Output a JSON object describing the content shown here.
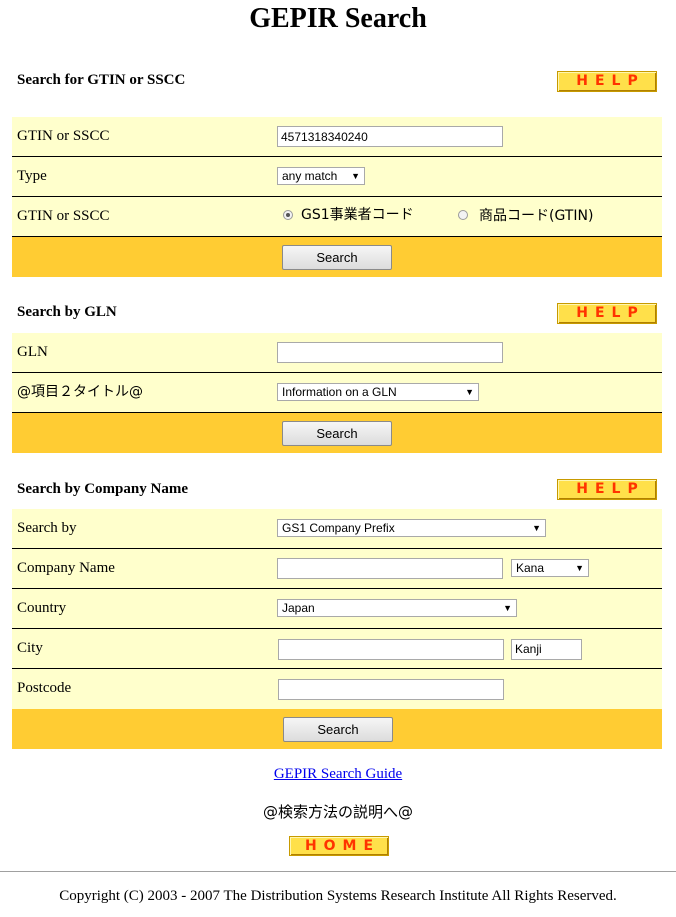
{
  "page": {
    "title": "GEPIR Search"
  },
  "help_label": "HELP",
  "home_label": "HOME",
  "gtin_section": {
    "heading": "Search for GTIN or SSCC",
    "rows": {
      "code_label": "GTIN or SSCC",
      "code_value": "4571318340240",
      "type_label": "Type",
      "type_value": "any match",
      "radio_label": "GTIN or SSCC",
      "radio_option1": "GS1事業者コード",
      "radio_option2": "商品コード(GTIN)"
    },
    "search_label": "Search"
  },
  "gln_section": {
    "heading": "Search by GLN",
    "rows": {
      "gln_label": "GLN",
      "gln_value": "",
      "item2_label": "@項目２タイトル@",
      "item2_value": "Information on a GLN"
    },
    "search_label": "Search"
  },
  "company_section": {
    "heading": "Search by Company Name",
    "rows": {
      "searchby_label": "Search by",
      "searchby_value": "GS1 Company Prefix",
      "company_label": "Company Name",
      "company_value": "",
      "kana_value": "Kana",
      "country_label": "Country",
      "country_value": "Japan",
      "city_label": "City",
      "city_value": "",
      "kanji_value": "Kanji",
      "postcode_label": "Postcode",
      "postcode_value": ""
    },
    "search_label": "Search"
  },
  "footer": {
    "guide_link": "GEPIR Search Guide",
    "jp_guide": "@検索方法の説明へ@",
    "copyright": "Copyright (C) 2003 - 2007 The Distribution Systems Research Institute All Rights Reserved."
  },
  "colors": {
    "row_bg": "#ffffcc",
    "button_bar_bg": "#ffcc33",
    "help_bg": "#ffe04a",
    "help_text": "#ff3300"
  }
}
